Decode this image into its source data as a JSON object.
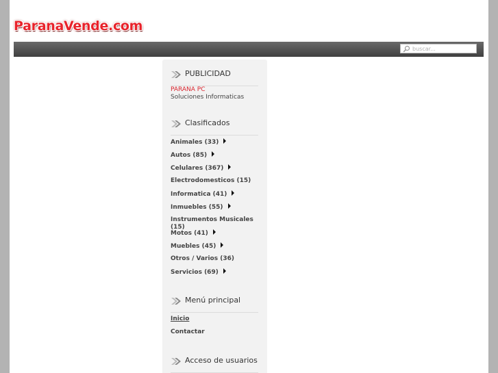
{
  "site": {
    "logo_text": "ParanaVende.com"
  },
  "search": {
    "placeholder": "buscar..."
  },
  "publicidad": {
    "title": "PUBLICIDAD",
    "ad_name": "PARANA PC",
    "ad_desc": "Soluciones Informaticas"
  },
  "clasificados": {
    "title": "Clasificados",
    "items": [
      {
        "label": "Animales (33)",
        "has_sub": true
      },
      {
        "label": "Autos (85)",
        "has_sub": true
      },
      {
        "label": "Celulares (367)",
        "has_sub": true
      },
      {
        "label": "Electrodomesticos (15)",
        "has_sub": false
      },
      {
        "label": "Informatica (41)",
        "has_sub": true
      },
      {
        "label": "Inmuebles (55)",
        "has_sub": true
      },
      {
        "label": "Instrumentos Musicales (15)",
        "has_sub": false
      },
      {
        "label": "Motos (41)",
        "has_sub": true
      },
      {
        "label": "Muebles (45)",
        "has_sub": true
      },
      {
        "label": "Otros / Varios (36)",
        "has_sub": false
      },
      {
        "label": "Servicios (69)",
        "has_sub": true
      }
    ]
  },
  "menu_principal": {
    "title": "Menú principal",
    "items": [
      {
        "label": "Inicio",
        "active": true
      },
      {
        "label": "Contactar",
        "active": false
      }
    ]
  },
  "acceso": {
    "title": "Acceso de usuarios"
  },
  "colors": {
    "background": "#b3b3b3",
    "logo_red": "#e8232b",
    "navbar_dark": "#3f3f3f",
    "sidebar_bg": "#f2f2f2",
    "ad_red": "#d9262f"
  }
}
